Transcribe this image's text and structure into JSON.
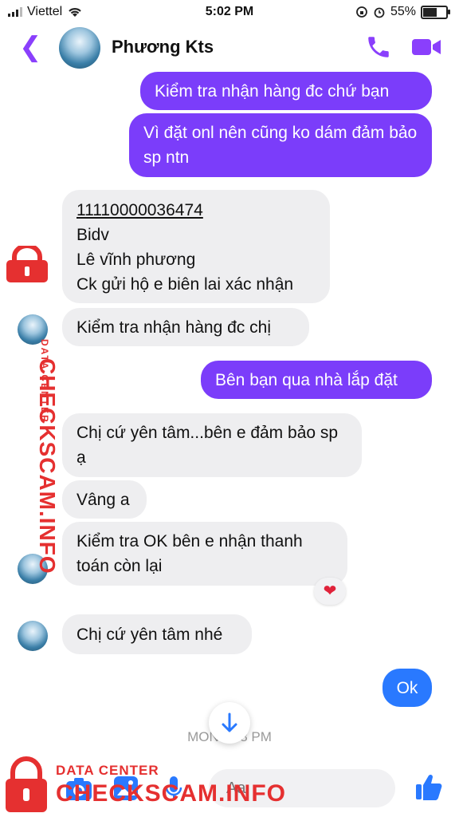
{
  "status": {
    "carrier": "Viettel",
    "time": "5:02 PM",
    "battery": "55%",
    "battery_level": 0.55
  },
  "header": {
    "contact_name": "Phương Kts"
  },
  "messages": [
    {
      "from": "me",
      "text": "Kiểm tra nhận hàng đc chứ bạn"
    },
    {
      "from": "me",
      "text": "Vì đặt onl nên cũng ko dám đảm bảo sp ntn"
    },
    {
      "from": "them",
      "account": "11110000036474",
      "lines": [
        "Bidv",
        "Lê vĩnh phương",
        "Ck gửi hộ e biên lai xác nhận"
      ]
    },
    {
      "from": "them",
      "text": "Kiểm tra nhận hàng đc chị"
    },
    {
      "from": "me",
      "text": "Bên bạn qua nhà lắp đặt"
    },
    {
      "from": "them",
      "text": "Chị cứ yên tâm...bên e đảm bảo sp ạ"
    },
    {
      "from": "them",
      "text": "Vâng a"
    },
    {
      "from": "them",
      "text": "Kiểm tra OK bên e nhận thanh toán còn lại",
      "reaction": "❤"
    },
    {
      "from": "them",
      "text": "Chị cứ yên tâm nhé"
    },
    {
      "from": "me",
      "text": "Ok"
    }
  ],
  "timestamp": "MON … 8 PM",
  "composer": {
    "placeholder": "Aa"
  },
  "watermark": {
    "line1": "DATA CENTER",
    "line2": "CHECKSCAM.INFO"
  },
  "colors": {
    "accent": "#7b3dfa",
    "incoming_bg": "#eeeef0",
    "watermark": "#e53030"
  }
}
